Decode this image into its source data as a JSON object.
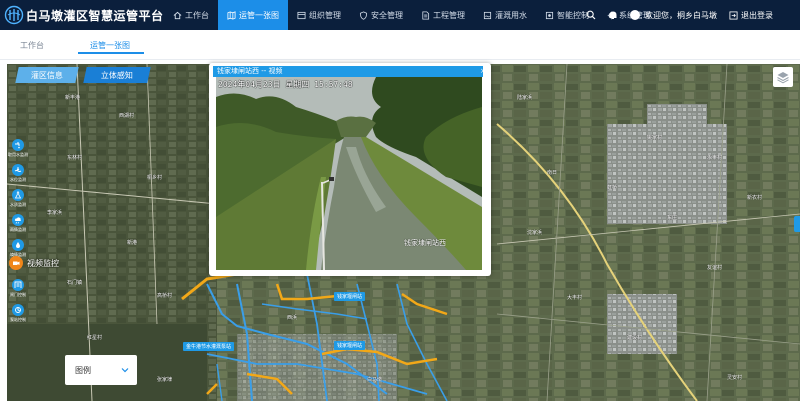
{
  "app": {
    "title": "白马墩灌区智慧运管平台"
  },
  "nav": {
    "items": [
      {
        "label": "工作台",
        "icon": "home-icon"
      },
      {
        "label": "运管一张图",
        "icon": "map-icon",
        "active": true
      },
      {
        "label": "组织管理",
        "icon": "org-icon"
      },
      {
        "label": "安全管理",
        "icon": "shield-icon"
      },
      {
        "label": "工程管理",
        "icon": "document-icon"
      },
      {
        "label": "灌溉用水",
        "icon": "water-icon"
      },
      {
        "label": "智能控制",
        "icon": "control-icon"
      },
      {
        "label": "系统管理",
        "icon": "gear-icon"
      }
    ]
  },
  "user": {
    "welcome": "欢迎您，桐乡白马墩",
    "logout": "退出登录"
  },
  "tabs": [
    {
      "label": "工作台"
    },
    {
      "label": "运管一张图",
      "active": true
    }
  ],
  "map": {
    "buttons": {
      "area": "灌区信息",
      "three_d": "立体感知"
    },
    "tools": [
      {
        "label": "取用水监测",
        "icon": "water-tap-icon"
      },
      {
        "label": "水位监测",
        "icon": "water-level-icon"
      },
      {
        "label": "水质监测",
        "icon": "flask-icon"
      },
      {
        "label": "雨情监测",
        "icon": "cloud-rain-icon"
      },
      {
        "label": "墒情监测",
        "icon": "soil-icon"
      }
    ],
    "video_button": "视频监控",
    "tools_lower": [
      {
        "label": "闸门控制",
        "icon": "gate-icon"
      },
      {
        "label": "泵站控制",
        "icon": "pump-icon"
      }
    ],
    "legend": "图例",
    "place_names": [
      "新丰港",
      "西湖村",
      "东林村",
      "桐乡村",
      "李家浜",
      "新港",
      "石门镇",
      "高桥村",
      "红星村",
      "张家埭",
      "陆家浜",
      "姚家村",
      "永丰村",
      "虹桥",
      "南日",
      "东庄",
      "沈家浜",
      "新农村",
      "大丰村",
      "友谊村",
      "建设村",
      "灵安村",
      "西浜",
      "白马墩"
    ],
    "stations": [
      "钱家堰闸站",
      "钱家堰闸站",
      "金牛港节水灌溉泵站"
    ]
  },
  "video": {
    "title": "钱家埭闸站西 -- 视频",
    "timestamp": "2024年04月23日 星期四 15:57:48",
    "camera_name": "钱家埭闸站西"
  },
  "colors": {
    "topbar": "#0b1f3c",
    "accent": "#1c8ee8",
    "canal": "#3a9ee8",
    "road": "#f2a818"
  }
}
